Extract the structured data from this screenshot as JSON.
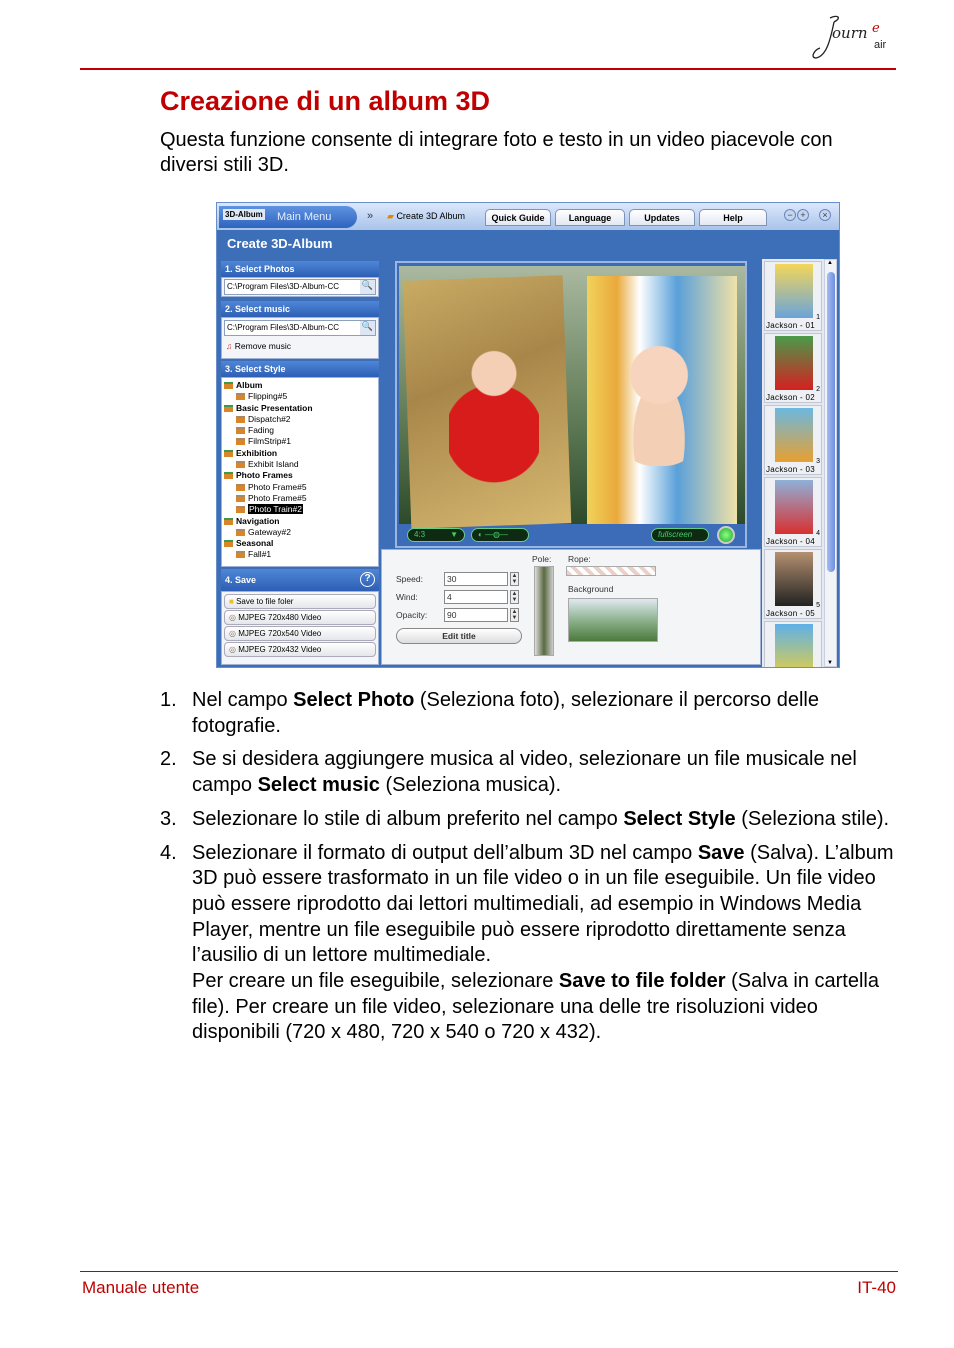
{
  "header": {
    "logo_text": "Journe air"
  },
  "title": "Creazione di un album 3D",
  "intro": "Questa funzione consente di integrare foto e testo in un video piacevole con diversi stili 3D.",
  "app": {
    "logo": "3D-Album",
    "main_menu": "Main Menu",
    "tabs": [
      "Create 3D Album",
      "Quick Guide",
      "Language",
      "Updates",
      "Help"
    ],
    "window_title": "Create 3D-Album",
    "sections": {
      "photos": "1. Select Photos",
      "music": "2. Select music",
      "style": "3. Select Style",
      "save": "4. Save"
    },
    "photos_path": "C:\\Program Files\\3D-Album-CC",
    "music_path": "C:\\Program Files\\3D-Album-CC",
    "remove_music": "Remove music",
    "styles": [
      {
        "cat": "Album",
        "items": [
          "Flipping#5"
        ]
      },
      {
        "cat": "Basic Presentation",
        "items": [
          "Dispatch#2",
          "Fading",
          "FilmStrip#1"
        ]
      },
      {
        "cat": "Exhibition",
        "items": [
          "Exhibit Island"
        ]
      },
      {
        "cat": "Photo Frames",
        "items": [
          "Photo Frame#5",
          "Photo Frame#5",
          "Photo Train#2"
        ]
      },
      {
        "cat": "Navigation",
        "items": [
          "Gateway#2"
        ]
      },
      {
        "cat": "Seasonal",
        "items": [
          "Fall#1"
        ]
      }
    ],
    "selected_style": "Photo Train#2",
    "save_options": [
      "Save to file foler",
      "MJPEG 720x480 Video",
      "MJPEG 720x540 Video",
      "MJPEG 720x432 Video"
    ],
    "aspect": "4:3",
    "fullscreen": "fullscreen",
    "props": {
      "speed_label": "Speed:",
      "speed": "30",
      "wind_label": "Wind:",
      "wind": "4",
      "opacity_label": "Opacity:",
      "opacity": "90",
      "edit_title": "Edit title",
      "pole": "Pole:",
      "rope": "Rope:",
      "background": "Background"
    },
    "thumbnails": [
      {
        "n": "1",
        "cap": "Jackson - 01"
      },
      {
        "n": "2",
        "cap": "Jackson - 02"
      },
      {
        "n": "3",
        "cap": "Jackson - 03"
      },
      {
        "n": "4",
        "cap": "Jackson - 04"
      },
      {
        "n": "5",
        "cap": "Jackson - 05"
      }
    ]
  },
  "steps": [
    [
      {
        "t": "Nel campo "
      },
      {
        "t": "Select Photo",
        "b": true
      },
      {
        "t": " (Seleziona foto), selezionare il percorso delle fotografie."
      }
    ],
    [
      {
        "t": "Se si desidera aggiungere musica al video, selezionare un file musicale nel campo "
      },
      {
        "t": "Select music",
        "b": true
      },
      {
        "t": " (Seleziona musica)."
      }
    ],
    [
      {
        "t": "Selezionare lo stile di album preferito nel campo "
      },
      {
        "t": "Select Style",
        "b": true
      },
      {
        "t": " (Seleziona stile)."
      }
    ],
    [
      {
        "t": "Selezionare il formato di output dell’album 3D nel campo "
      },
      {
        "t": "Save",
        "b": true
      },
      {
        "t": " (Salva). L’album 3D può essere trasformato in un file video o in un file eseguibile. Un file video può essere riprodotto dai lettori multimediali, ad esempio in Windows Media Player, mentre un file eseguibile può essere riprodotto direttamente senza l’ausilio di un lettore multimediale."
      },
      {
        "br": true
      },
      {
        "t": "Per creare un file eseguibile, selezionare "
      },
      {
        "t": "Save to file folder",
        "b": true
      },
      {
        "t": " (Salva in cartella file). Per creare un file video, selezionare una delle tre risoluzioni video disponibili (720 x 480, 720 x 540 o 720 x 432)."
      }
    ]
  ],
  "footer": {
    "left": "Manuale utente",
    "right": "IT-40"
  },
  "colors": {
    "accent": "#c00000",
    "app_blue": "#3d6fb8"
  }
}
